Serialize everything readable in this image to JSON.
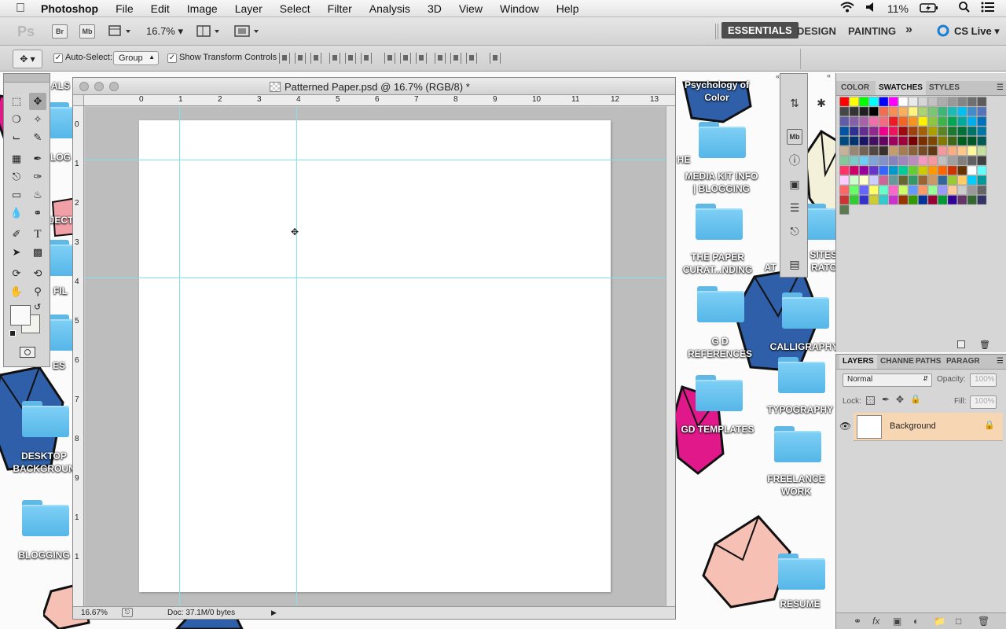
{
  "menubar": {
    "app": "Photoshop",
    "items": [
      "File",
      "Edit",
      "Image",
      "Layer",
      "Select",
      "Filter",
      "Analysis",
      "3D",
      "View",
      "Window",
      "Help"
    ],
    "battery": "11%"
  },
  "appbar": {
    "logo": "Ps",
    "br": "Br",
    "mb": "Mb",
    "zoom": "16.7%",
    "workspaces": [
      "ESSENTIALS",
      "DESIGN",
      "PAINTING"
    ],
    "more": "»",
    "cslive": "CS Live"
  },
  "options": {
    "auto_select_label": "Auto-Select:",
    "auto_select_value": "Group",
    "transform_label": "Show Transform Controls"
  },
  "document": {
    "title": "Patterned Paper.psd @ 16.7% (RGB/8) *",
    "zoom": "16.67%",
    "doc_info": "Doc: 37.1M/0 bytes",
    "ruler_h": [
      "0",
      "1",
      "2",
      "3",
      "4",
      "5",
      "6",
      "7",
      "8",
      "9",
      "10",
      "11",
      "12",
      "13"
    ],
    "ruler_v": [
      "0",
      "1",
      "2",
      "3",
      "4",
      "5",
      "6",
      "7",
      "8",
      "9",
      "1",
      "1"
    ]
  },
  "swatch_panel": {
    "tabs": [
      "COLOR",
      "SWATCHES",
      "STYLES"
    ],
    "active_tab": "SWATCHES"
  },
  "layers_panel": {
    "tabs": [
      "LAYERS",
      "CHANNE",
      "PATHS",
      "PARAGR"
    ],
    "blend_mode": "Normal",
    "opacity_label": "Opacity:",
    "opacity_value": "100%",
    "lock_label": "Lock:",
    "fill_label": "Fill:",
    "fill_value": "100%",
    "layer_name": "Background"
  },
  "desktop": {
    "labels": {
      "psych1": "Psychology of",
      "psych2": "Color",
      "media1": "MEDIA KIT INFO",
      "media2": "| BLOGGING",
      "paper1": "THE PAPER",
      "paper2": "CURAT...NDING",
      "gd1": "G D",
      "gd2": "REFERENCES",
      "calligraphy": "CALLIGRAPHY",
      "typography": "TYPOGRAPHY",
      "gdtemplates": "GD TEMPLATES",
      "freelance1": "FREELANCE",
      "freelance2": "WORK",
      "resume": "RESUME",
      "desktop1": "DESKTOP",
      "desktop2": "BACKGROUN",
      "blogging": "BLOGGING",
      "sites1": "SITES",
      "sites2": "RATO",
      "at": "AT",
      "he": "HE",
      "ject": "JECT",
      "fil": "FIL",
      "es": "ES",
      "als": "ALS",
      "logo": "LOG"
    }
  },
  "colors": {
    "guide": "#7fe3ea",
    "layer_highlight": "#f7d6b3",
    "folder": "#6cc6f0"
  }
}
